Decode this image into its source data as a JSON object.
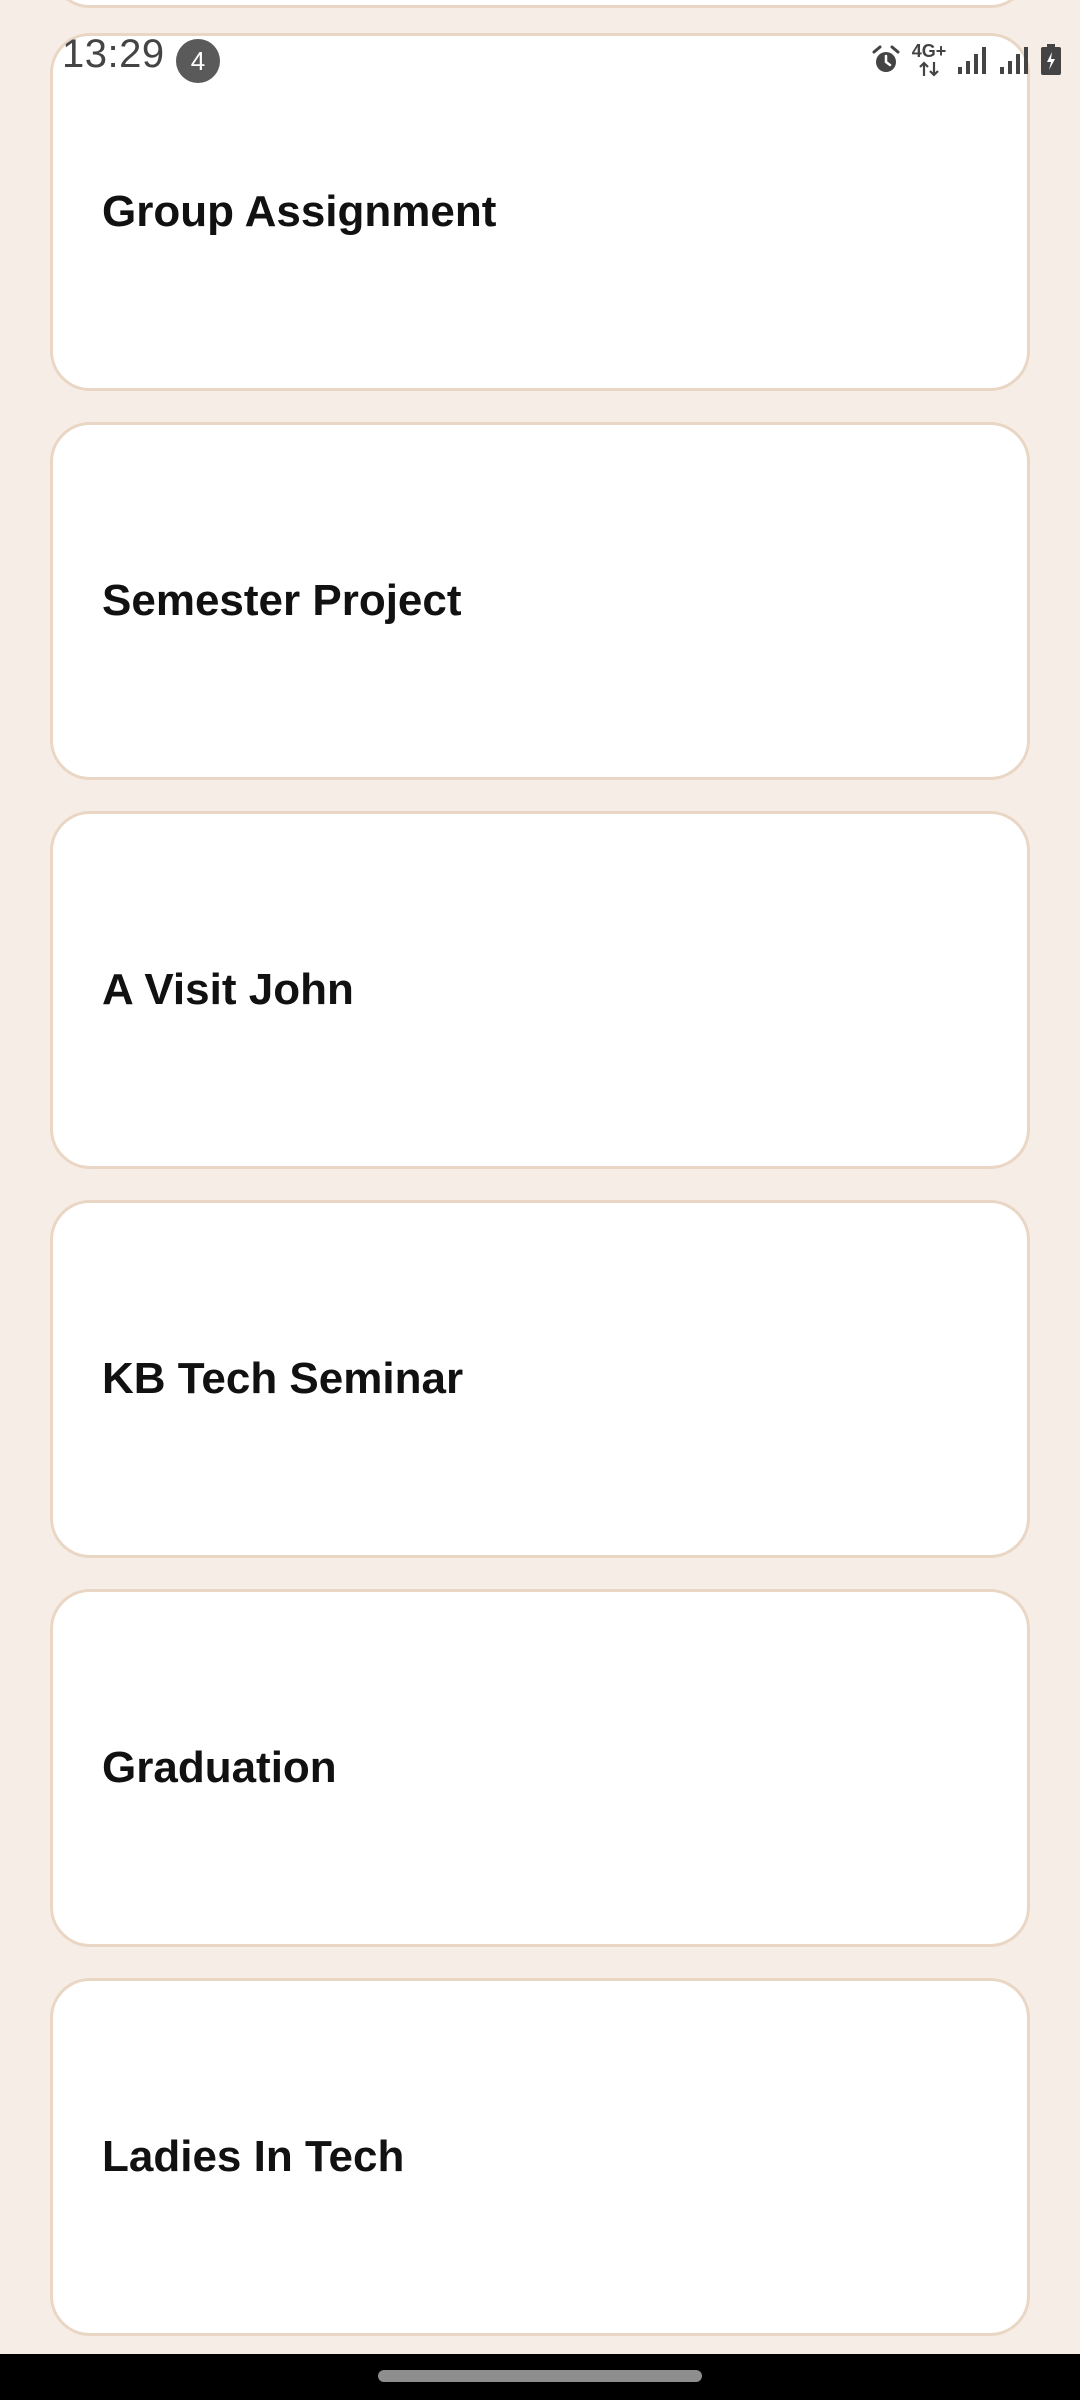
{
  "status_bar": {
    "time": "13:29",
    "notification_count": "4",
    "network_label": "4G+",
    "icons": [
      "alarm-icon",
      "network-4g-plus-icon",
      "signal-icon",
      "signal-icon",
      "battery-charging-icon"
    ]
  },
  "cards": [
    {
      "title": ""
    },
    {
      "title": "Group Assignment"
    },
    {
      "title": "Semester Project"
    },
    {
      "title": "A Visit John"
    },
    {
      "title": "KB Tech Seminar"
    },
    {
      "title": "Graduation"
    },
    {
      "title": "Ladies In Tech"
    }
  ],
  "colors": {
    "background": "#f6eee6",
    "card_background": "#ffffff",
    "card_border": "#e9d6c4",
    "title_text": "#111111",
    "nav_bar": "#000000"
  }
}
